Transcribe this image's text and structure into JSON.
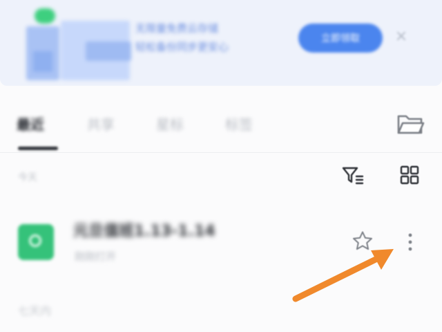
{
  "banner": {
    "text_line1": "无限量免费云存储",
    "text_line2": "轻松备份同步更安心",
    "button_label": "立即领取",
    "close_glyph": "×",
    "colors": {
      "background": "#eef2fb",
      "button": "#4b85ee",
      "text": "#6c8fe0"
    }
  },
  "tabs": {
    "items": [
      {
        "label": "最近",
        "active": true
      },
      {
        "label": "共享",
        "active": false
      },
      {
        "label": "星标",
        "active": false
      },
      {
        "label": "标签",
        "active": false
      }
    ],
    "folder_icon": "folder-icon"
  },
  "toolbar": {
    "section_label": "今天",
    "filter_icon": "filter-list-icon",
    "grid_icon": "grid-view-icon"
  },
  "file": {
    "name": "元旦值班1.13-1.14",
    "meta": "刚刚打开",
    "icon": "spreadsheet-icon",
    "icon_color": "#35c27a",
    "star_icon": "star-outline-icon",
    "more_icon": "more-vertical-icon"
  },
  "list": {
    "bottom_label": "七天内"
  },
  "annotation": {
    "arrow_color": "#f0892c"
  }
}
